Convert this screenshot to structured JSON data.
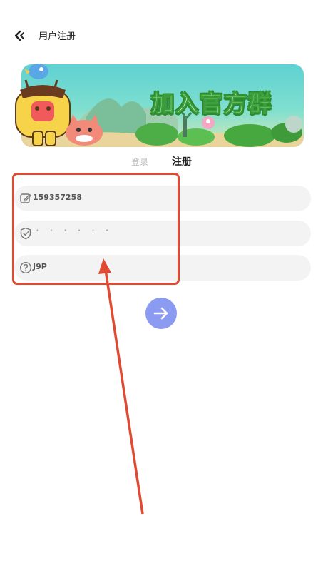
{
  "header": {
    "title": "用户注册",
    "back_icon": "double-chevron-left-icon"
  },
  "banner": {
    "text": "加入官方群"
  },
  "tabs": {
    "login_label": "登录",
    "register_label": "注册"
  },
  "form": {
    "phone_value": "159357258",
    "phone_icon": "edit-icon",
    "password_value": "· · · · · ·",
    "password_icon": "shield-check-icon",
    "code_value": "J9P",
    "code_icon": "question-circle-icon"
  },
  "submit": {
    "icon": "arrow-right-icon"
  },
  "colors": {
    "accent": "#8c9bf2",
    "annotation": "#e04a33",
    "banner_green": "#2e8a2e"
  }
}
